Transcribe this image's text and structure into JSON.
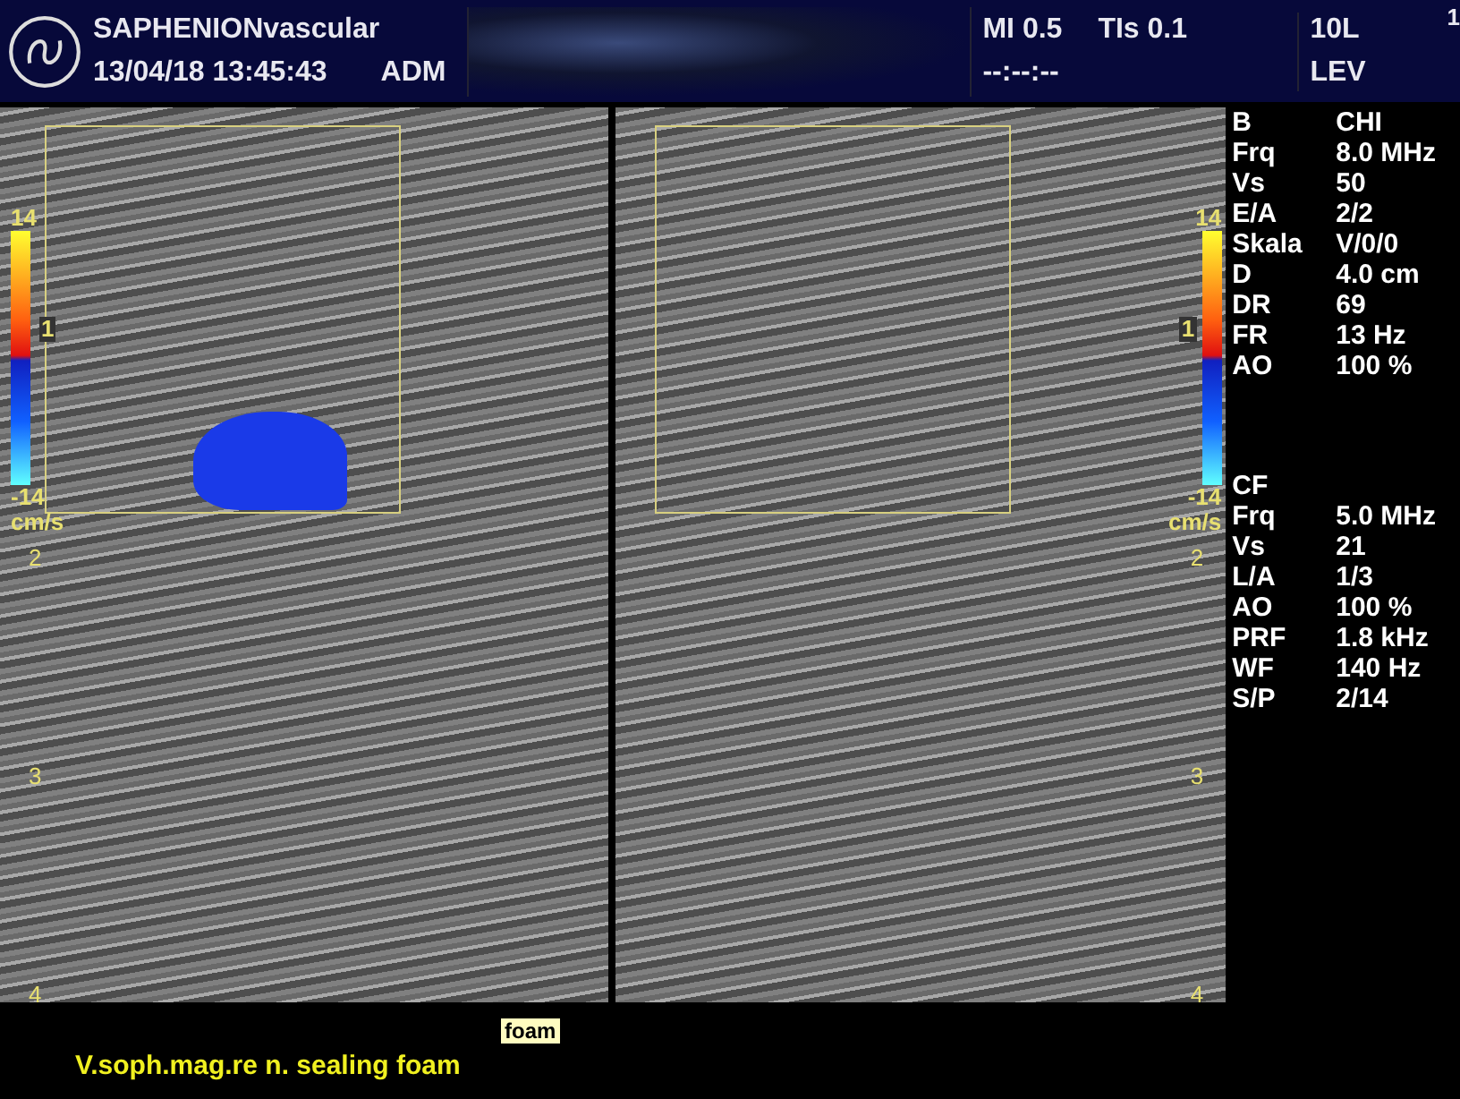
{
  "header": {
    "title": "SAPHENIONvascular",
    "datetime": "13/04/18 13:45:43",
    "operator": "ADM",
    "mi": "MI 0.5",
    "tis": "TIs 0.1",
    "timer": "--:--:--",
    "probe": "10L",
    "preset": "LEV",
    "edge_text": "1"
  },
  "panels": [
    {
      "kind": "left",
      "color_flow": true,
      "scale_max": "14",
      "scale_mid": "1",
      "scale_min": "-14",
      "unit": "cm/s",
      "depths": [
        "2",
        "3",
        "4"
      ]
    },
    {
      "kind": "right",
      "color_flow": false,
      "scale_max": "14",
      "scale_mid": "1",
      "scale_min": "-14",
      "unit": "cm/s",
      "depths": [
        "2",
        "3",
        "4"
      ]
    }
  ],
  "b_mode": [
    {
      "label": "B",
      "value": "CHI"
    },
    {
      "label": "Frq",
      "value": "8.0 MHz"
    },
    {
      "label": "Vs",
      "value": "50"
    },
    {
      "label": "E/A",
      "value": "2/2"
    },
    {
      "label": "Skala",
      "value": "V/0/0"
    },
    {
      "label": "D",
      "value": "4.0 cm"
    },
    {
      "label": "DR",
      "value": "69"
    },
    {
      "label": "FR",
      "value": "13 Hz"
    },
    {
      "label": "AO",
      "value": "100 %"
    }
  ],
  "color_flow": [
    {
      "label": "CF"
    },
    {
      "label": "Frq",
      "value": "5.0 MHz"
    },
    {
      "label": "Vs",
      "value": "21"
    },
    {
      "label": "L/A",
      "value": "1/3"
    },
    {
      "label": "AO",
      "value": "100 %"
    },
    {
      "label": "PRF",
      "value": "1.8 kHz"
    },
    {
      "label": "WF",
      "value": "140 Hz"
    },
    {
      "label": "S/P",
      "value": "2/14"
    }
  ],
  "footer": {
    "tag": "foam",
    "annotation": "V.soph.mag.re n. sealing foam"
  }
}
